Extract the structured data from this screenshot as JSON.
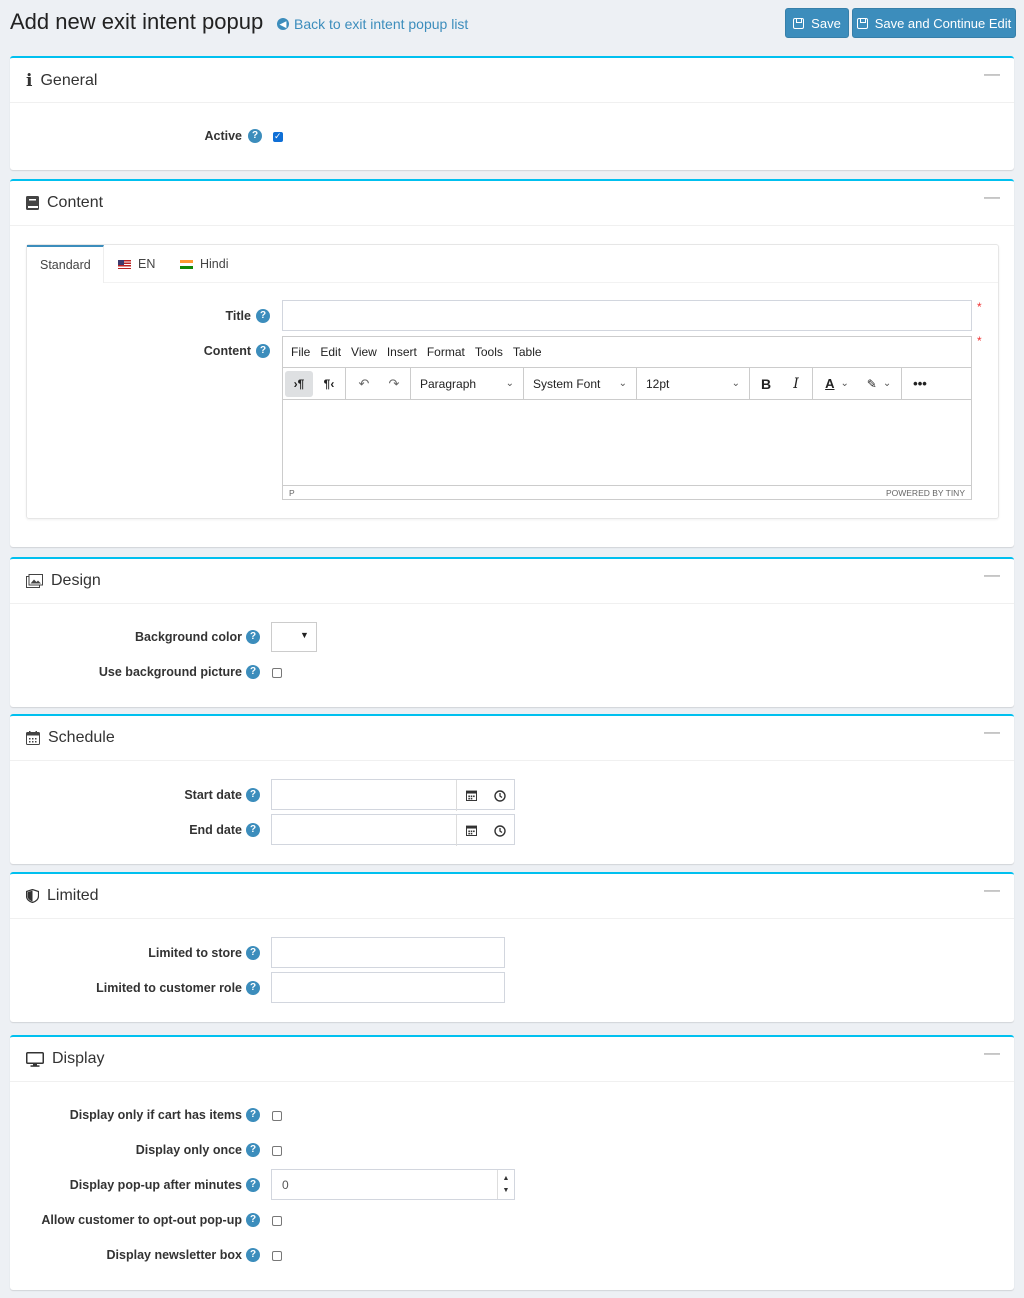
{
  "header": {
    "title": "Add new exit intent popup",
    "back_link": "Back to exit intent popup list",
    "save_label": "Save",
    "save_continue_label": "Save and Continue Edit"
  },
  "general": {
    "title": "General",
    "active_label": "Active",
    "active_checked": true
  },
  "content": {
    "title": "Content",
    "tabs": [
      "Standard",
      "EN",
      "Hindi"
    ],
    "title_label": "Title",
    "title_value": "",
    "content_label": "Content",
    "editor": {
      "menu": [
        "File",
        "Edit",
        "View",
        "Insert",
        "Format",
        "Tools",
        "Table"
      ],
      "block_format": "Paragraph",
      "font_family": "System Font",
      "font_size": "12pt",
      "status_path": "P",
      "branding": "POWERED BY TINY"
    }
  },
  "design": {
    "title": "Design",
    "bg_color_label": "Background color",
    "use_bg_picture_label": "Use background picture"
  },
  "schedule": {
    "title": "Schedule",
    "start_label": "Start date",
    "end_label": "End date"
  },
  "limited": {
    "title": "Limited",
    "store_label": "Limited to store",
    "role_label": "Limited to customer role"
  },
  "display": {
    "title": "Display",
    "cart_label": "Display only if cart has items",
    "once_label": "Display only once",
    "minutes_label": "Display pop-up after minutes",
    "minutes_value": "0",
    "optout_label": "Allow customer to opt-out pop-up",
    "newsletter_label": "Display newsletter box"
  },
  "colors": {
    "accent": "#3c8dbc",
    "card_border": "#00c0ef",
    "page_bg": "#edf0f4"
  },
  "icons": [
    "info-icon",
    "book-icon",
    "image-icon",
    "calendar-icon",
    "shield-icon",
    "monitor-icon",
    "clock-icon",
    "help-icon"
  ]
}
